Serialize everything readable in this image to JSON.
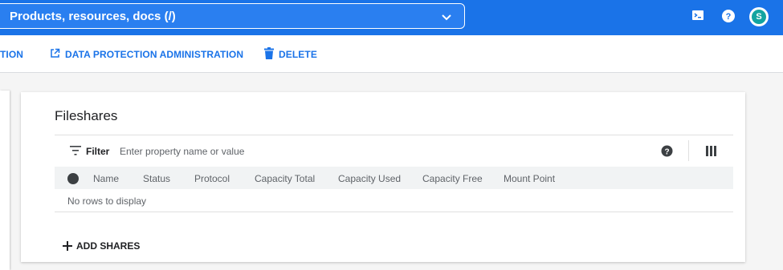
{
  "topbar": {
    "search_text": "Products, resources, docs (/)",
    "avatar_letter": "S",
    "icons": [
      "terminal-icon",
      "help-icon",
      "chevron-down-icon"
    ]
  },
  "actions": {
    "partial_label": "TION",
    "data_protection_label": "DATA PROTECTION ADMINISTRATION",
    "delete_label": "DELETE"
  },
  "card": {
    "title": "Fileshares",
    "filter_label": "Filter",
    "filter_placeholder": "Enter property name or value",
    "columns": [
      "Name",
      "Status",
      "Protocol",
      "Capacity Total",
      "Capacity Used",
      "Capacity Free",
      "Mount Point"
    ],
    "empty_message": "No rows to display",
    "add_label": "ADD SHARES"
  },
  "colors": {
    "brand_blue": "#1a73e8",
    "avatar_teal": "#12a4a1"
  }
}
